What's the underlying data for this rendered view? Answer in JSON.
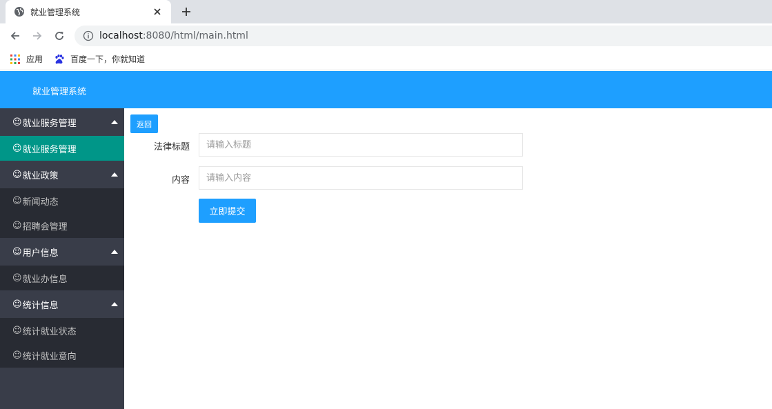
{
  "browser": {
    "tab_title": "就业管理系统",
    "url_host": "localhost",
    "url_rest": ":8080/html/main.html",
    "bookmarks": [
      {
        "label": "应用",
        "icon": "apps-grid-icon"
      },
      {
        "label": "百度一下，你就知道",
        "icon": "baidu-paw-icon"
      }
    ]
  },
  "app": {
    "brand": "就业管理系统",
    "sidebar": {
      "smile_glyph": "☺",
      "groups": [
        {
          "label": "就业服务管理",
          "children": [
            {
              "label": "就业服务管理",
              "active": true
            }
          ]
        },
        {
          "label": "就业政策",
          "children": [
            {
              "label": "新闻动态"
            },
            {
              "label": "招聘会管理"
            }
          ]
        },
        {
          "label": "用户信息",
          "children": [
            {
              "label": "就业办信息"
            }
          ]
        },
        {
          "label": "统计信息",
          "children": [
            {
              "label": "统计就业状态"
            },
            {
              "label": "统计就业意向"
            }
          ]
        }
      ]
    },
    "form": {
      "back_label": "返回",
      "title_label": "法律标题",
      "title_placeholder": "请输入标题",
      "content_label": "内容",
      "content_placeholder": "请输入内容",
      "submit_label": "立即提交"
    },
    "colors": {
      "header": "#1e9fff",
      "sidebar": "#393d49",
      "sidebar_child": "#282b33",
      "active": "#009688"
    }
  }
}
